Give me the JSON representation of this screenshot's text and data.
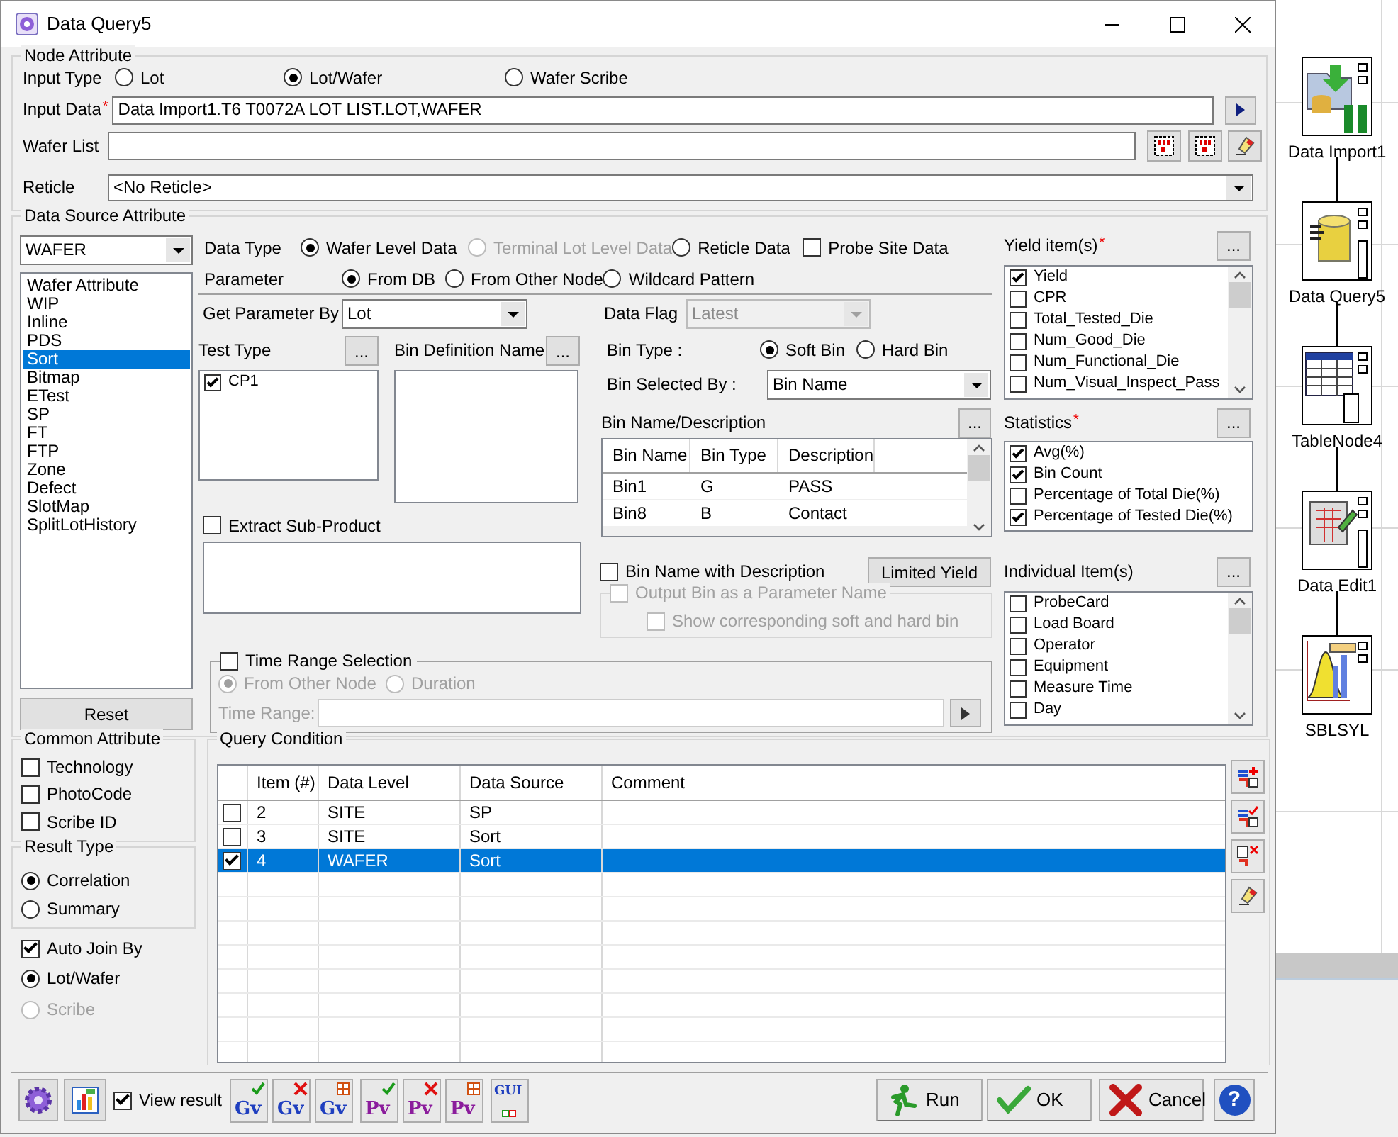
{
  "window": {
    "title": "Data Query5"
  },
  "node_attribute": {
    "title": "Node Attribute",
    "input_type": {
      "label": "Input Type",
      "options": [
        {
          "label": "Lot",
          "selected": false
        },
        {
          "label": "Lot/Wafer",
          "selected": true
        },
        {
          "label": "Wafer Scribe",
          "selected": false
        }
      ]
    },
    "input_data": {
      "label": "Input Data",
      "required_mark": "*",
      "value": "Data Import1.T6 T0072A LOT LIST.LOT,WAFER"
    },
    "wafer_list": {
      "label": "Wafer List"
    },
    "reticle": {
      "label": "Reticle",
      "value": "<No Reticle>"
    }
  },
  "data_source": {
    "title": "Data Source Attribute",
    "level": "WAFER",
    "sources": [
      {
        "label": "Wafer Attribute",
        "selected": false
      },
      {
        "label": "WIP",
        "selected": false
      },
      {
        "label": "Inline",
        "selected": false
      },
      {
        "label": "PDS",
        "selected": false
      },
      {
        "label": "Sort",
        "selected": true
      },
      {
        "label": "Bitmap",
        "selected": false
      },
      {
        "label": "ETest",
        "selected": false
      },
      {
        "label": "SP",
        "selected": false
      },
      {
        "label": "FT",
        "selected": false
      },
      {
        "label": "FTP",
        "selected": false
      },
      {
        "label": "Zone",
        "selected": false
      },
      {
        "label": "Defect",
        "selected": false
      },
      {
        "label": "SlotMap",
        "selected": false
      },
      {
        "label": "SplitLotHistory",
        "selected": false
      }
    ],
    "reset_button": "Reset",
    "data_type": {
      "label": "Data Type",
      "options": [
        {
          "label": "Wafer Level Data",
          "selected": true,
          "disabled": false
        },
        {
          "label": "Terminal Lot Level Data",
          "selected": false,
          "disabled": true
        },
        {
          "label": "Reticle Data",
          "selected": false,
          "disabled": false
        }
      ]
    },
    "probe_site_data": {
      "label": "Probe Site Data",
      "checked": false
    },
    "parameter": {
      "label": "Parameter",
      "options": [
        {
          "label": "From DB",
          "selected": true
        },
        {
          "label": "From Other Node",
          "selected": false
        },
        {
          "label": "Wildcard Pattern",
          "selected": false
        }
      ]
    },
    "get_parameter_by": {
      "label": "Get Parameter By",
      "value": "Lot"
    },
    "data_flag": {
      "label": "Data Flag",
      "value": "Latest",
      "disabled": true
    },
    "test_type": {
      "label": "Test Type",
      "button": "...",
      "items": [
        {
          "label": "CP1",
          "checked": true
        }
      ]
    },
    "bin_definition_name": {
      "label": "Bin Definition Name",
      "button": "..."
    },
    "extract_sub_product": {
      "label": "Extract Sub-Product",
      "checked": false
    },
    "bin_type": {
      "label": "Bin Type :",
      "options": [
        {
          "label": "Soft Bin",
          "selected": true
        },
        {
          "label": "Hard Bin",
          "selected": false
        }
      ]
    },
    "bin_selected_by": {
      "label": "Bin Selected By :",
      "value": "Bin Name"
    },
    "bin_table": {
      "label": "Bin Name/Description",
      "button": "...",
      "columns": [
        "Bin Name",
        "Bin Type",
        "Description"
      ],
      "rows": [
        [
          "Bin1",
          "G",
          "PASS"
        ],
        [
          "Bin8",
          "B",
          "Contact"
        ]
      ]
    },
    "bin_name_with_description": {
      "label": "Bin Name with Description",
      "checked": false
    },
    "limited_yield_button": "Limited Yield",
    "output_bin": {
      "label": "Output Bin as a Parameter Name",
      "checked": false,
      "disabled": true
    },
    "show_soft_hard_bin": {
      "label": "Show corresponding soft and hard bin",
      "checked": false,
      "disabled": true
    },
    "time_range": {
      "label": "Time Range Selection",
      "checked": false,
      "options": [
        {
          "label": "From Other Node",
          "selected": true,
          "disabled": true
        },
        {
          "label": "Duration",
          "selected": false,
          "disabled": true
        }
      ],
      "range_label": "Time Range:"
    },
    "yield_items": {
      "label": "Yield item(s)",
      "required_mark": "*",
      "button": "...",
      "items": [
        {
          "label": "Yield",
          "checked": true
        },
        {
          "label": "CPR",
          "checked": false
        },
        {
          "label": "Total_Tested_Die",
          "checked": false
        },
        {
          "label": "Num_Good_Die",
          "checked": false
        },
        {
          "label": "Num_Functional_Die",
          "checked": false
        },
        {
          "label": "Num_Visual_Inspect_Pass",
          "checked": false
        }
      ]
    },
    "statistics": {
      "label": "Statistics",
      "required_mark": "*",
      "button": "...",
      "items": [
        {
          "label": "Avg(%)",
          "checked": true
        },
        {
          "label": "Bin Count",
          "checked": true
        },
        {
          "label": "Percentage of Total Die(%)",
          "checked": false
        },
        {
          "label": "Percentage of Tested Die(%)",
          "checked": true
        }
      ]
    },
    "individual_items": {
      "label": "Individual Item(s)",
      "button": "...",
      "items": [
        {
          "label": "ProbeCard",
          "checked": false
        },
        {
          "label": "Load Board",
          "checked": false
        },
        {
          "label": "Operator",
          "checked": false
        },
        {
          "label": "Equipment",
          "checked": false
        },
        {
          "label": "Measure Time",
          "checked": false
        },
        {
          "label": "Day",
          "checked": false
        }
      ]
    }
  },
  "common_attribute": {
    "title": "Common Attribute",
    "items": [
      {
        "label": "Technology",
        "checked": false
      },
      {
        "label": "PhotoCode",
        "checked": false
      },
      {
        "label": "Scribe ID",
        "checked": false
      }
    ]
  },
  "result_type": {
    "title": "Result Type",
    "options": [
      {
        "label": "Correlation",
        "selected": true
      },
      {
        "label": "Summary",
        "selected": false
      }
    ]
  },
  "auto_join": {
    "label": "Auto Join By",
    "checked": true,
    "options": [
      {
        "label": "Lot/Wafer",
        "selected": true,
        "disabled": false
      },
      {
        "label": "Scribe",
        "selected": false,
        "disabled": true
      }
    ]
  },
  "query_condition": {
    "title": "Query Condition",
    "columns": [
      "Item (#)",
      "Data Level",
      "Data Source",
      "Comment"
    ],
    "rows": [
      {
        "checked": false,
        "selected": false,
        "cells": [
          "2",
          "SITE",
          "SP"
        ]
      },
      {
        "checked": false,
        "selected": false,
        "cells": [
          "3",
          "SITE",
          "Sort"
        ]
      },
      {
        "checked": true,
        "selected": true,
        "cells": [
          "4",
          "WAFER",
          "Sort"
        ]
      }
    ]
  },
  "toolbar": {
    "view_result": {
      "label": "View result",
      "checked": true
    },
    "tools": [
      {
        "label": "Gv",
        "kind": "check",
        "color": "#1f3fbf"
      },
      {
        "label": "Gv",
        "kind": "cross",
        "color": "#1f3fbf"
      },
      {
        "label": "Gv",
        "kind": "export",
        "color": "#1f3fbf"
      },
      {
        "label": "Pv",
        "kind": "check",
        "color": "#8b1c9c"
      },
      {
        "label": "Pv",
        "kind": "cross",
        "color": "#8b1c9c"
      },
      {
        "label": "Pv",
        "kind": "export",
        "color": "#8b1c9c"
      },
      {
        "label": "GUI",
        "kind": "boxes",
        "color": "#1f3fbf"
      }
    ]
  },
  "buttons": [
    {
      "label": "Run",
      "kind": "run"
    },
    {
      "label": "OK",
      "kind": "ok"
    },
    {
      "label": "Cancel",
      "kind": "cancel"
    },
    {
      "label": "?",
      "kind": "help"
    }
  ],
  "flow": {
    "nodes": [
      {
        "label": "Data Import1",
        "kind": "import"
      },
      {
        "label": "Data Query5",
        "kind": "query"
      },
      {
        "label": "TableNode4",
        "kind": "table"
      },
      {
        "label": "Data Edit1",
        "kind": "edit"
      },
      {
        "label": "SBLSYL",
        "kind": "stats"
      }
    ]
  }
}
